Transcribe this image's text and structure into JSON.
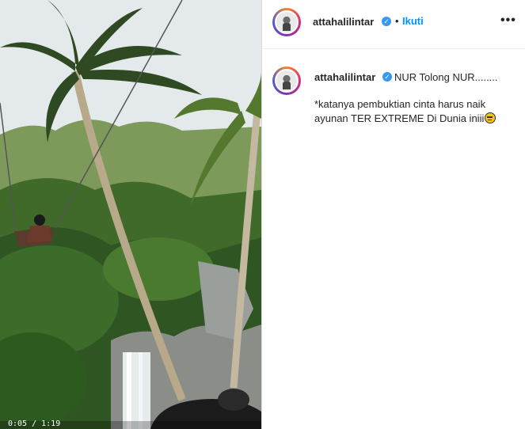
{
  "post": {
    "author": "attahalilintar",
    "follow_label": "Ikuti",
    "more_label": "•••",
    "separator": "•"
  },
  "caption": {
    "username": "attahalilintar",
    "text": "NUR Tolong NUR........",
    "line1": "*katanya pembuktian cinta harus naik",
    "line2": "ayunan TER EXTREME Di Dunia iniii"
  },
  "video": {
    "time": "0:05 / 1:19"
  },
  "icons": {
    "verified": "verified-badge-icon",
    "more": "more-options-icon",
    "emoji": "unamused-face-icon"
  },
  "colors": {
    "follow": "#0095f6",
    "verified": "#3897f0"
  }
}
